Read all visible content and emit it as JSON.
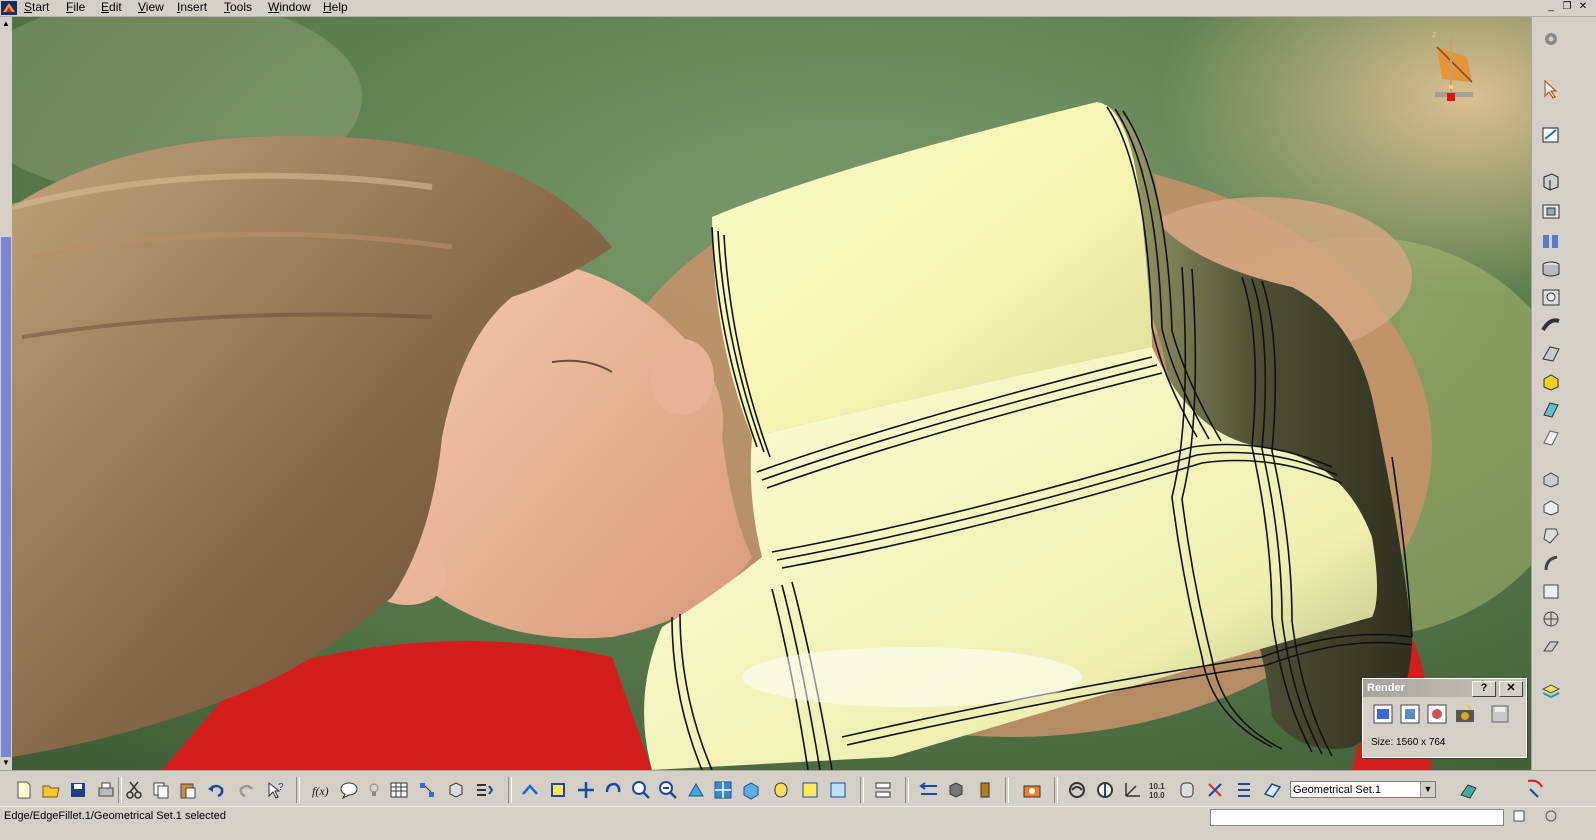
{
  "menubar": {
    "items": [
      "Start",
      "File",
      "Edit",
      "View",
      "Insert",
      "Tools",
      "Window",
      "Help"
    ]
  },
  "window_buttons": {
    "minimize": "_",
    "restore": "❐",
    "close": "✕"
  },
  "render_panel": {
    "title": "Render",
    "help_label": "?",
    "close_label": "✕",
    "size_text": "Size: 1560 x 764",
    "icons": [
      "render-quick-icon",
      "render-options-icon",
      "render-settings-icon",
      "capture-camera-icon",
      "save-render-icon"
    ]
  },
  "toolbar": {
    "geometrical_set": "Geometrical Set.1",
    "icons": [
      "new-file-icon",
      "open-folder-icon",
      "save-icon",
      "print-icon",
      "cut-icon",
      "copy-icon",
      "paste-icon",
      "undo-icon",
      "redo-icon",
      "whats-this-icon",
      "formula-icon",
      "knowledge-advisor-icon",
      "light-bulb-icon",
      "table-icon",
      "graph-icon",
      "analysis-icon",
      "update-icon",
      "fly-mode-icon",
      "fit-all-icon",
      "pan-icon",
      "rotate-icon",
      "zoom-in-icon",
      "zoom-out-icon",
      "normal-view-icon",
      "multi-view-icon",
      "iso-view-icon",
      "shading-icon",
      "hide-show-icon",
      "swap-space-icon",
      "measure-between-icon",
      "measure-item-icon",
      "mass-icon",
      "capture-icon",
      "hybrid-icon",
      "axis-icon",
      "coordinates-icon",
      "scan-icon",
      "copy-paste-icon",
      "hierarchy-icon",
      "geometric-set-icon",
      "work-object-icon",
      "catia-logo"
    ]
  },
  "right_toolbar": {
    "icons": [
      "gear-icon",
      "select-arrow-icon",
      "sketch-icon",
      "extrude-icon",
      "pocket-icon",
      "shaft-icon",
      "groove-icon",
      "hole-icon",
      "rib-icon",
      "slot-icon",
      "multi-section-icon",
      "solid-combine-icon",
      "draft-icon",
      "shell-icon",
      "thickness-icon",
      "chamfer-icon",
      "fillet-icon",
      "translate-icon",
      "symmetry-icon",
      "pattern-icon",
      "scaling-icon",
      "layers-icon"
    ]
  },
  "statusbar": {
    "text": "Edge/EdgeFillet.1/Geometrical Set.1 selected"
  },
  "colors": {
    "chrome": "#d4d0c8",
    "part_shade": "#f6f7b8",
    "edge_lines": "#1a1a1a",
    "scroll_thumb": "#7b85d6"
  }
}
